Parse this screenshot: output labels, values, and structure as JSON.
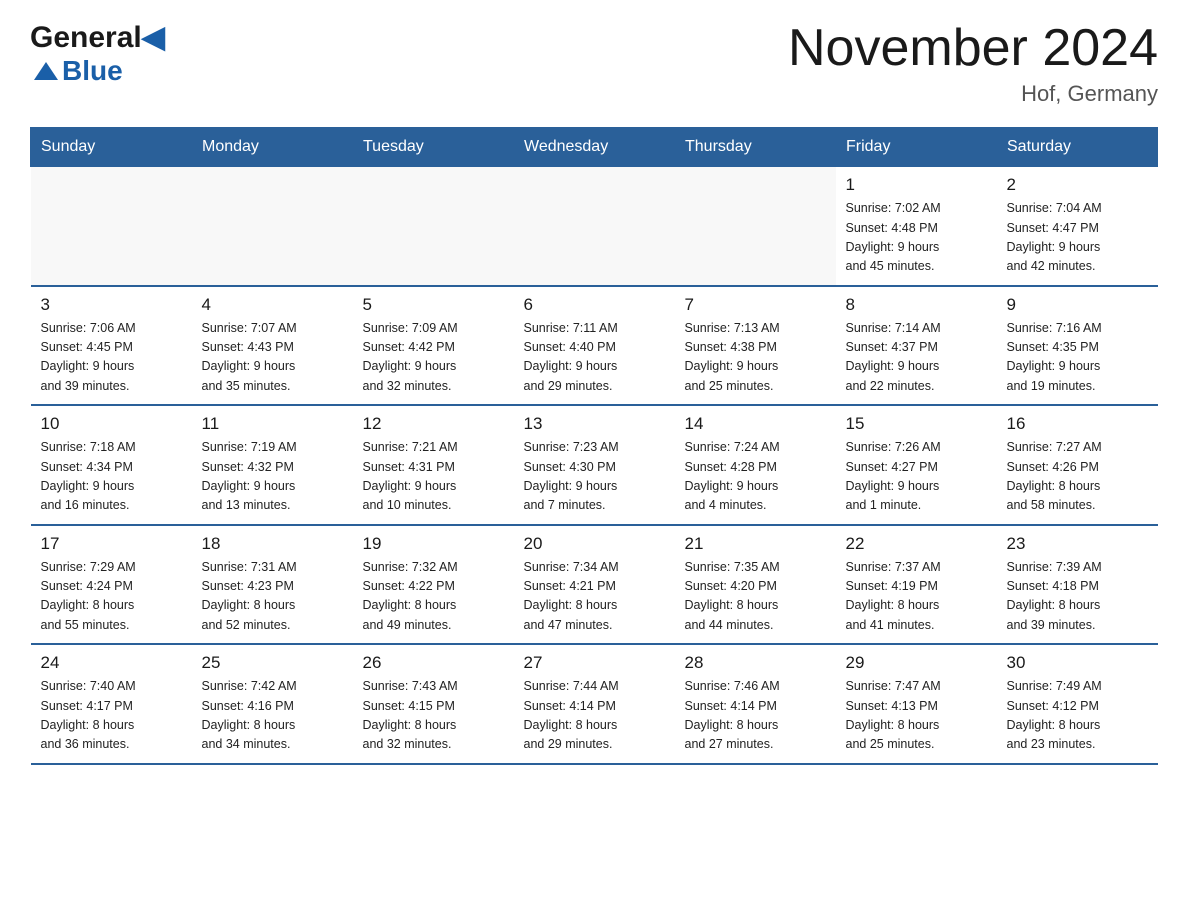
{
  "header": {
    "logo_general": "General",
    "logo_blue": "Blue",
    "title": "November 2024",
    "subtitle": "Hof, Germany"
  },
  "weekdays": [
    "Sunday",
    "Monday",
    "Tuesday",
    "Wednesday",
    "Thursday",
    "Friday",
    "Saturday"
  ],
  "weeks": [
    [
      {
        "day": "",
        "info": ""
      },
      {
        "day": "",
        "info": ""
      },
      {
        "day": "",
        "info": ""
      },
      {
        "day": "",
        "info": ""
      },
      {
        "day": "",
        "info": ""
      },
      {
        "day": "1",
        "info": "Sunrise: 7:02 AM\nSunset: 4:48 PM\nDaylight: 9 hours\nand 45 minutes."
      },
      {
        "day": "2",
        "info": "Sunrise: 7:04 AM\nSunset: 4:47 PM\nDaylight: 9 hours\nand 42 minutes."
      }
    ],
    [
      {
        "day": "3",
        "info": "Sunrise: 7:06 AM\nSunset: 4:45 PM\nDaylight: 9 hours\nand 39 minutes."
      },
      {
        "day": "4",
        "info": "Sunrise: 7:07 AM\nSunset: 4:43 PM\nDaylight: 9 hours\nand 35 minutes."
      },
      {
        "day": "5",
        "info": "Sunrise: 7:09 AM\nSunset: 4:42 PM\nDaylight: 9 hours\nand 32 minutes."
      },
      {
        "day": "6",
        "info": "Sunrise: 7:11 AM\nSunset: 4:40 PM\nDaylight: 9 hours\nand 29 minutes."
      },
      {
        "day": "7",
        "info": "Sunrise: 7:13 AM\nSunset: 4:38 PM\nDaylight: 9 hours\nand 25 minutes."
      },
      {
        "day": "8",
        "info": "Sunrise: 7:14 AM\nSunset: 4:37 PM\nDaylight: 9 hours\nand 22 minutes."
      },
      {
        "day": "9",
        "info": "Sunrise: 7:16 AM\nSunset: 4:35 PM\nDaylight: 9 hours\nand 19 minutes."
      }
    ],
    [
      {
        "day": "10",
        "info": "Sunrise: 7:18 AM\nSunset: 4:34 PM\nDaylight: 9 hours\nand 16 minutes."
      },
      {
        "day": "11",
        "info": "Sunrise: 7:19 AM\nSunset: 4:32 PM\nDaylight: 9 hours\nand 13 minutes."
      },
      {
        "day": "12",
        "info": "Sunrise: 7:21 AM\nSunset: 4:31 PM\nDaylight: 9 hours\nand 10 minutes."
      },
      {
        "day": "13",
        "info": "Sunrise: 7:23 AM\nSunset: 4:30 PM\nDaylight: 9 hours\nand 7 minutes."
      },
      {
        "day": "14",
        "info": "Sunrise: 7:24 AM\nSunset: 4:28 PM\nDaylight: 9 hours\nand 4 minutes."
      },
      {
        "day": "15",
        "info": "Sunrise: 7:26 AM\nSunset: 4:27 PM\nDaylight: 9 hours\nand 1 minute."
      },
      {
        "day": "16",
        "info": "Sunrise: 7:27 AM\nSunset: 4:26 PM\nDaylight: 8 hours\nand 58 minutes."
      }
    ],
    [
      {
        "day": "17",
        "info": "Sunrise: 7:29 AM\nSunset: 4:24 PM\nDaylight: 8 hours\nand 55 minutes."
      },
      {
        "day": "18",
        "info": "Sunrise: 7:31 AM\nSunset: 4:23 PM\nDaylight: 8 hours\nand 52 minutes."
      },
      {
        "day": "19",
        "info": "Sunrise: 7:32 AM\nSunset: 4:22 PM\nDaylight: 8 hours\nand 49 minutes."
      },
      {
        "day": "20",
        "info": "Sunrise: 7:34 AM\nSunset: 4:21 PM\nDaylight: 8 hours\nand 47 minutes."
      },
      {
        "day": "21",
        "info": "Sunrise: 7:35 AM\nSunset: 4:20 PM\nDaylight: 8 hours\nand 44 minutes."
      },
      {
        "day": "22",
        "info": "Sunrise: 7:37 AM\nSunset: 4:19 PM\nDaylight: 8 hours\nand 41 minutes."
      },
      {
        "day": "23",
        "info": "Sunrise: 7:39 AM\nSunset: 4:18 PM\nDaylight: 8 hours\nand 39 minutes."
      }
    ],
    [
      {
        "day": "24",
        "info": "Sunrise: 7:40 AM\nSunset: 4:17 PM\nDaylight: 8 hours\nand 36 minutes."
      },
      {
        "day": "25",
        "info": "Sunrise: 7:42 AM\nSunset: 4:16 PM\nDaylight: 8 hours\nand 34 minutes."
      },
      {
        "day": "26",
        "info": "Sunrise: 7:43 AM\nSunset: 4:15 PM\nDaylight: 8 hours\nand 32 minutes."
      },
      {
        "day": "27",
        "info": "Sunrise: 7:44 AM\nSunset: 4:14 PM\nDaylight: 8 hours\nand 29 minutes."
      },
      {
        "day": "28",
        "info": "Sunrise: 7:46 AM\nSunset: 4:14 PM\nDaylight: 8 hours\nand 27 minutes."
      },
      {
        "day": "29",
        "info": "Sunrise: 7:47 AM\nSunset: 4:13 PM\nDaylight: 8 hours\nand 25 minutes."
      },
      {
        "day": "30",
        "info": "Sunrise: 7:49 AM\nSunset: 4:12 PM\nDaylight: 8 hours\nand 23 minutes."
      }
    ]
  ]
}
